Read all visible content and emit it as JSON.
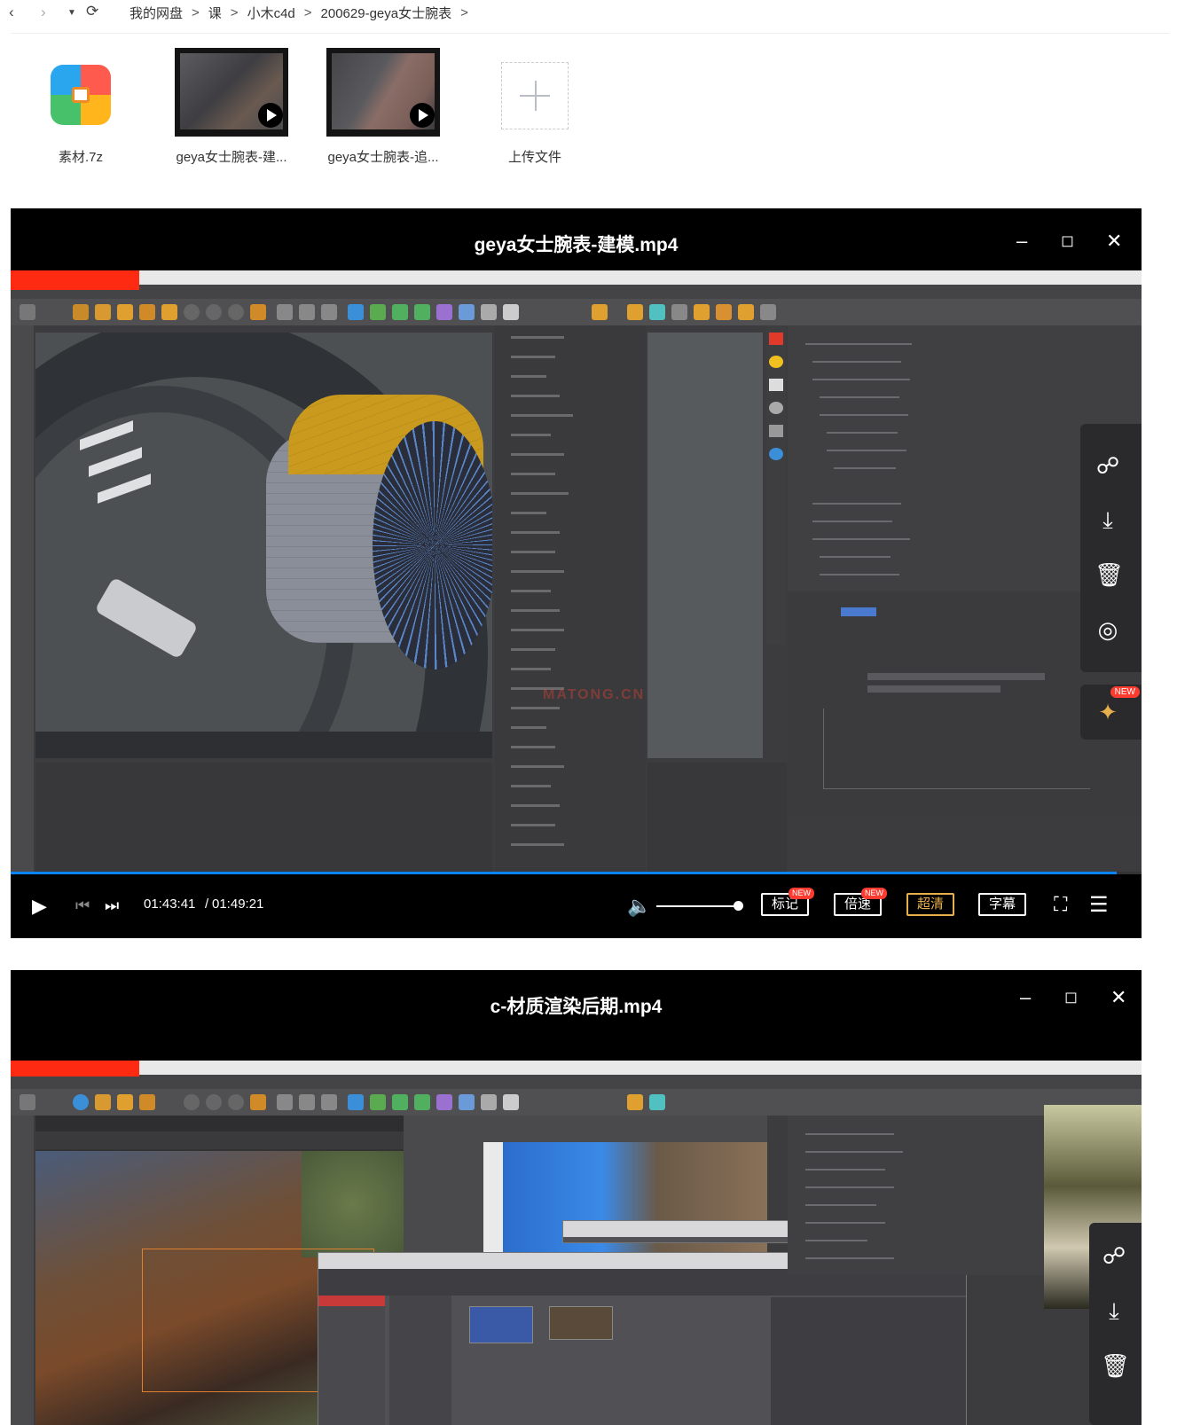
{
  "breadcrumb": {
    "items": [
      "我的网盘",
      "课",
      "小木c4d",
      "200629-geya女士腕表"
    ],
    "separator": ">"
  },
  "files": [
    {
      "name": "素材.7z",
      "type": "archive"
    },
    {
      "name": "geya女士腕表-建...",
      "type": "video"
    },
    {
      "name": "geya女士腕表-追...",
      "type": "video"
    },
    {
      "name": "上传文件",
      "type": "upload"
    }
  ],
  "player1": {
    "title": "geya女士腕表-建模.mp4",
    "time_current": "01:43:41",
    "time_separator": "/",
    "time_total": "01:49:21",
    "progress_fraction": 0.978,
    "volume_fraction": 1.0,
    "buttons": {
      "mark": "标记",
      "speed": "倍速",
      "quality": "超清",
      "subtitle": "字幕"
    },
    "new_badge": "NEW",
    "pin_badge": "NEW",
    "watermark": "MATONG.CN"
  },
  "player2": {
    "title": "c-材质渲染后期.mp4"
  },
  "colors": {
    "progress": "#0a84ff",
    "quality_highlight": "#e8b04c",
    "badge": "#ff3b30",
    "recording_bar": "#ff2a12"
  },
  "icons": {
    "back": "chevron-left-icon",
    "forward": "chevron-right-icon",
    "history": "caret-down-icon",
    "refresh": "refresh-icon",
    "share": "share-icon",
    "download": "download-icon",
    "delete": "trash-icon",
    "settings": "target-icon",
    "pin": "pin-icon"
  }
}
